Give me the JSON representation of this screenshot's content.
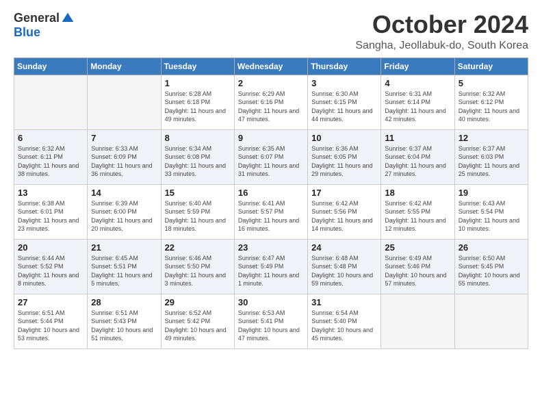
{
  "header": {
    "logo_general": "General",
    "logo_blue": "Blue",
    "month_title": "October 2024",
    "location": "Sangha, Jeollabuk-do, South Korea"
  },
  "weekdays": [
    "Sunday",
    "Monday",
    "Tuesday",
    "Wednesday",
    "Thursday",
    "Friday",
    "Saturday"
  ],
  "weeks": [
    [
      {
        "day": "",
        "info": ""
      },
      {
        "day": "",
        "info": ""
      },
      {
        "day": "1",
        "info": "Sunrise: 6:28 AM\nSunset: 6:18 PM\nDaylight: 11 hours and 49 minutes."
      },
      {
        "day": "2",
        "info": "Sunrise: 6:29 AM\nSunset: 6:16 PM\nDaylight: 11 hours and 47 minutes."
      },
      {
        "day": "3",
        "info": "Sunrise: 6:30 AM\nSunset: 6:15 PM\nDaylight: 11 hours and 44 minutes."
      },
      {
        "day": "4",
        "info": "Sunrise: 6:31 AM\nSunset: 6:14 PM\nDaylight: 11 hours and 42 minutes."
      },
      {
        "day": "5",
        "info": "Sunrise: 6:32 AM\nSunset: 6:12 PM\nDaylight: 11 hours and 40 minutes."
      }
    ],
    [
      {
        "day": "6",
        "info": "Sunrise: 6:32 AM\nSunset: 6:11 PM\nDaylight: 11 hours and 38 minutes."
      },
      {
        "day": "7",
        "info": "Sunrise: 6:33 AM\nSunset: 6:09 PM\nDaylight: 11 hours and 36 minutes."
      },
      {
        "day": "8",
        "info": "Sunrise: 6:34 AM\nSunset: 6:08 PM\nDaylight: 11 hours and 33 minutes."
      },
      {
        "day": "9",
        "info": "Sunrise: 6:35 AM\nSunset: 6:07 PM\nDaylight: 11 hours and 31 minutes."
      },
      {
        "day": "10",
        "info": "Sunrise: 6:36 AM\nSunset: 6:05 PM\nDaylight: 11 hours and 29 minutes."
      },
      {
        "day": "11",
        "info": "Sunrise: 6:37 AM\nSunset: 6:04 PM\nDaylight: 11 hours and 27 minutes."
      },
      {
        "day": "12",
        "info": "Sunrise: 6:37 AM\nSunset: 6:03 PM\nDaylight: 11 hours and 25 minutes."
      }
    ],
    [
      {
        "day": "13",
        "info": "Sunrise: 6:38 AM\nSunset: 6:01 PM\nDaylight: 11 hours and 23 minutes."
      },
      {
        "day": "14",
        "info": "Sunrise: 6:39 AM\nSunset: 6:00 PM\nDaylight: 11 hours and 20 minutes."
      },
      {
        "day": "15",
        "info": "Sunrise: 6:40 AM\nSunset: 5:59 PM\nDaylight: 11 hours and 18 minutes."
      },
      {
        "day": "16",
        "info": "Sunrise: 6:41 AM\nSunset: 5:57 PM\nDaylight: 11 hours and 16 minutes."
      },
      {
        "day": "17",
        "info": "Sunrise: 6:42 AM\nSunset: 5:56 PM\nDaylight: 11 hours and 14 minutes."
      },
      {
        "day": "18",
        "info": "Sunrise: 6:42 AM\nSunset: 5:55 PM\nDaylight: 11 hours and 12 minutes."
      },
      {
        "day": "19",
        "info": "Sunrise: 6:43 AM\nSunset: 5:54 PM\nDaylight: 11 hours and 10 minutes."
      }
    ],
    [
      {
        "day": "20",
        "info": "Sunrise: 6:44 AM\nSunset: 5:52 PM\nDaylight: 11 hours and 8 minutes."
      },
      {
        "day": "21",
        "info": "Sunrise: 6:45 AM\nSunset: 5:51 PM\nDaylight: 11 hours and 5 minutes."
      },
      {
        "day": "22",
        "info": "Sunrise: 6:46 AM\nSunset: 5:50 PM\nDaylight: 11 hours and 3 minutes."
      },
      {
        "day": "23",
        "info": "Sunrise: 6:47 AM\nSunset: 5:49 PM\nDaylight: 11 hours and 1 minute."
      },
      {
        "day": "24",
        "info": "Sunrise: 6:48 AM\nSunset: 5:48 PM\nDaylight: 10 hours and 59 minutes."
      },
      {
        "day": "25",
        "info": "Sunrise: 6:49 AM\nSunset: 5:46 PM\nDaylight: 10 hours and 57 minutes."
      },
      {
        "day": "26",
        "info": "Sunrise: 6:50 AM\nSunset: 5:45 PM\nDaylight: 10 hours and 55 minutes."
      }
    ],
    [
      {
        "day": "27",
        "info": "Sunrise: 6:51 AM\nSunset: 5:44 PM\nDaylight: 10 hours and 53 minutes."
      },
      {
        "day": "28",
        "info": "Sunrise: 6:51 AM\nSunset: 5:43 PM\nDaylight: 10 hours and 51 minutes."
      },
      {
        "day": "29",
        "info": "Sunrise: 6:52 AM\nSunset: 5:42 PM\nDaylight: 10 hours and 49 minutes."
      },
      {
        "day": "30",
        "info": "Sunrise: 6:53 AM\nSunset: 5:41 PM\nDaylight: 10 hours and 47 minutes."
      },
      {
        "day": "31",
        "info": "Sunrise: 6:54 AM\nSunset: 5:40 PM\nDaylight: 10 hours and 45 minutes."
      },
      {
        "day": "",
        "info": ""
      },
      {
        "day": "",
        "info": ""
      }
    ]
  ]
}
